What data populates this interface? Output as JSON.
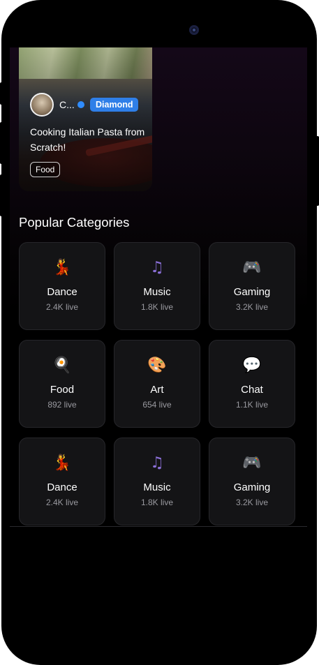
{
  "stream": {
    "host_name": "C...",
    "tier_badge": "Diamond",
    "title": "Cooking Italian Pasta from Scratch!",
    "tag": "Food"
  },
  "categories_section": {
    "title": "Popular Categories",
    "items": [
      {
        "icon": "dancer-icon",
        "glyph": "💃",
        "name": "Dance",
        "live": "2.4K live",
        "color": "#e8455a"
      },
      {
        "icon": "music-note-icon",
        "glyph": "♫",
        "name": "Music",
        "live": "1.8K live",
        "color": "#8a6fd6"
      },
      {
        "icon": "game-controller-icon",
        "glyph": "🎮",
        "name": "Gaming",
        "live": "3.2K live",
        "color": "#8a5fd0"
      },
      {
        "icon": "frying-pan-egg-icon",
        "glyph": "🍳",
        "name": "Food",
        "live": "892 live",
        "color": "#9a70e0"
      },
      {
        "icon": "artist-palette-icon",
        "glyph": "🎨",
        "name": "Art",
        "live": "654 live",
        "color": "#e8a07a"
      },
      {
        "icon": "speech-bubble-icon",
        "glyph": "💬",
        "name": "Chat",
        "live": "1.1K live",
        "color": "#e6e6f0"
      },
      {
        "icon": "dancer-icon",
        "glyph": "💃",
        "name": "Dance",
        "live": "2.4K live",
        "color": "#e8455a"
      },
      {
        "icon": "music-note-icon",
        "glyph": "♫",
        "name": "Music",
        "live": "1.8K live",
        "color": "#8a6fd6"
      },
      {
        "icon": "game-controller-icon",
        "glyph": "🎮",
        "name": "Gaming",
        "live": "3.2K live",
        "color": "#8a5fd0"
      }
    ]
  },
  "colors": {
    "badge": "#2f7fe8",
    "verified": "#2f8cff",
    "card_bg": "#141416"
  }
}
